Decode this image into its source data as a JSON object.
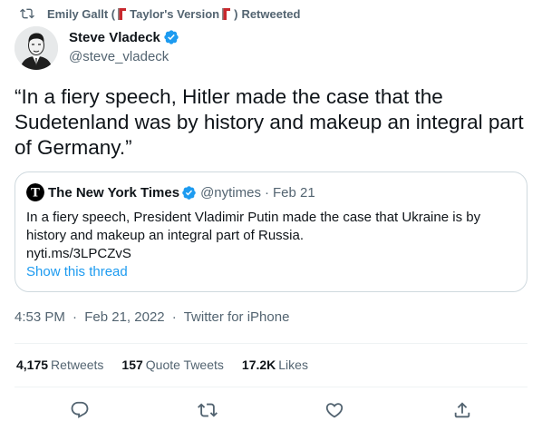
{
  "retweet_context": {
    "name_part1": "Emily Gallt (",
    "name_part2": "Taylor's Version",
    "name_part3": ")",
    "suffix": "Retweeted"
  },
  "author": {
    "name": "Steve Vladeck",
    "handle": "@steve_vladeck"
  },
  "tweet": {
    "text": "“In a fiery speech, Hitler made the case that the Sudetenland was by history and makeup an integral part of Germany.”"
  },
  "quoted_tweet": {
    "author_name": "The New York Times",
    "handle": "@nytimes",
    "dot": "·",
    "date": "Feb 21",
    "text": "In a fiery speech, President Vladimir Putin made the case that Ukraine is by history and makeup an integral part of Russia.",
    "link": "nyti.ms/3LPCZvS",
    "show_thread": "Show this thread"
  },
  "meta": {
    "time": "4:53 PM",
    "sep1": "·",
    "date": "Feb 21, 2022",
    "sep2": "·",
    "source": "Twitter for iPhone"
  },
  "stats": {
    "retweets_count": "4,175",
    "retweets_label": "Retweets",
    "quotes_count": "157",
    "quotes_label": "Quote Tweets",
    "likes_count": "17.2K",
    "likes_label": "Likes"
  },
  "icons": {
    "retweet": "retweet-icon",
    "flag": "red-scarf-flag-icon",
    "verified": "verified-badge-icon",
    "nyt_logo": "nyt-logo-icon",
    "reply": "reply-icon",
    "like": "heart-icon",
    "share": "share-icon"
  },
  "colors": {
    "text_primary": "#0f1419",
    "text_secondary": "#536471",
    "link": "#1d9bf0",
    "verified": "#1d9bf0",
    "border": "#cfd9de",
    "flag": "#c8282d"
  }
}
